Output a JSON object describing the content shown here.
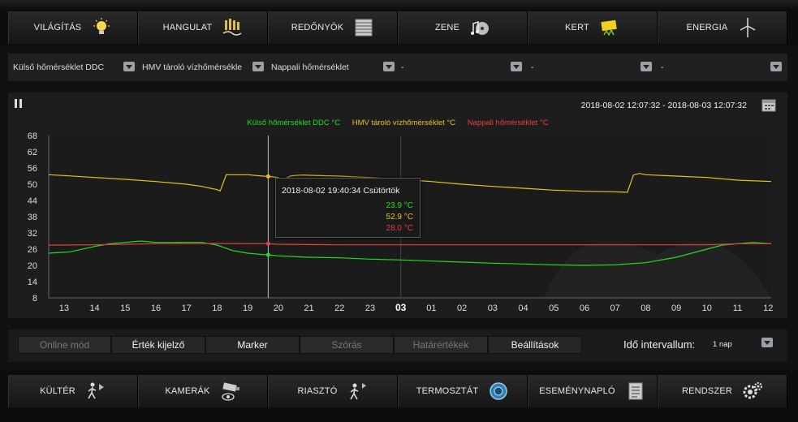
{
  "top_nav": [
    {
      "label": "VILÁGÍTÁS",
      "icon": "light-bulb-icon"
    },
    {
      "label": "HANGULAT",
      "icon": "mood-scene-icon"
    },
    {
      "label": "REDŐNYÖK",
      "icon": "blinds-icon"
    },
    {
      "label": "ZENE",
      "icon": "music-note-icon"
    },
    {
      "label": "KERT",
      "icon": "garden-icon"
    },
    {
      "label": "ENERGIA",
      "icon": "wind-turbine-icon"
    }
  ],
  "dropdowns": [
    {
      "label": "Külső hőmérséklet DDC"
    },
    {
      "label": "HMV tároló vízhőmérsékle"
    },
    {
      "label": "Nappali hőmérséklet"
    },
    {
      "label": "-"
    },
    {
      "label": "-"
    },
    {
      "label": "-"
    }
  ],
  "chart_header": {
    "range": "2018-08-02 12:07:32 - 2018-08-03 12:07:32"
  },
  "chart_data": {
    "type": "line",
    "y_ticks": [
      68,
      62,
      56,
      50,
      44,
      38,
      32,
      26,
      20,
      14,
      8
    ],
    "ylim": [
      8,
      68
    ],
    "x_ticks": [
      "13",
      "14",
      "15",
      "16",
      "17",
      "18",
      "19",
      "20",
      "21",
      "22",
      "23",
      "03",
      "01",
      "02",
      "03",
      "04",
      "05",
      "06",
      "07",
      "08",
      "09",
      "10",
      "11",
      "12"
    ],
    "xlim": [
      12.5,
      36.1
    ],
    "series": [
      {
        "name": "Külső hőmérséklet DDC °C",
        "color": "#22dd22",
        "x": [
          12.5,
          13.2,
          14,
          14.5,
          15,
          15.5,
          16,
          17,
          17.5,
          18,
          18.5,
          19,
          19.5,
          19.67,
          20,
          21,
          22,
          23,
          24,
          25,
          26,
          27,
          28,
          29,
          30,
          31,
          32,
          33,
          34,
          34.5,
          35,
          35.5,
          36.1
        ],
        "y": [
          24.5,
          25,
          27,
          28,
          28.5,
          29,
          28.5,
          28.5,
          28.5,
          27.5,
          25.5,
          24.5,
          24,
          23.9,
          23.5,
          23,
          22.8,
          22.3,
          22,
          21.6,
          21.2,
          20.8,
          20.5,
          20.2,
          20,
          20.2,
          21,
          23,
          26,
          27.5,
          28,
          28.5,
          28
        ]
      },
      {
        "name": "HMV tároló vízhőmérséklet °C",
        "color": "#e8c21a",
        "x": [
          12.5,
          13,
          14,
          15,
          16,
          17,
          17.5,
          18,
          18.1,
          18.3,
          19,
          19.5,
          19.67,
          20,
          20.1,
          20.4,
          20.5,
          20.8,
          21,
          22,
          23,
          24,
          25,
          26,
          27,
          28,
          29,
          30,
          31,
          31.4,
          31.6,
          31.8,
          32,
          33,
          34,
          35,
          36.1
        ],
        "y": [
          53.5,
          53.2,
          52.5,
          51.8,
          51,
          50,
          49.2,
          48,
          47.5,
          53.5,
          53.5,
          53,
          52.9,
          52.5,
          51.5,
          53,
          53.2,
          53.4,
          53.3,
          53,
          52.5,
          51.8,
          51,
          50,
          49.2,
          48.5,
          47.8,
          47.4,
          47.2,
          47,
          53.4,
          54,
          53.5,
          53,
          52.5,
          51.5,
          51
        ]
      },
      {
        "name": "Nappali hőmérséklet °C",
        "color": "#e64040",
        "x": [
          12.5,
          14,
          16,
          18,
          19.67,
          20,
          22,
          24,
          26,
          28,
          30,
          32,
          34,
          35,
          36.1
        ],
        "y": [
          27.5,
          27.6,
          28,
          28.1,
          28,
          27.8,
          27.6,
          27.6,
          27.6,
          27.6,
          27.6,
          27.6,
          27.6,
          28,
          28
        ]
      }
    ],
    "marker_x": 19.67,
    "grid": "vertical",
    "legend_position": "top-center"
  },
  "tooltip": {
    "header": "2018-08-02 19:40:34 Csütörtök",
    "values": [
      {
        "text": "23.9 °C",
        "color": "#22dd22"
      },
      {
        "text": "52.9 °C",
        "color": "#e8c21a"
      },
      {
        "text": "28.0 °C",
        "color": "#e64040"
      }
    ]
  },
  "controls": [
    {
      "label": "Online mód",
      "state": "disabled"
    },
    {
      "label": "Érték kijelző",
      "state": "active"
    },
    {
      "label": "Marker",
      "state": "active"
    },
    {
      "label": "Szórás",
      "state": "disabled"
    },
    {
      "label": "Határértékek",
      "state": "disabled"
    },
    {
      "label": "Beállítások",
      "state": "active"
    }
  ],
  "interval": {
    "label": "Idő intervallum:",
    "value": "1 nap"
  },
  "bottom_nav": [
    {
      "label": "KÜLTÉR",
      "icon": "outdoor-motion-icon"
    },
    {
      "label": "KAMERÁK",
      "icon": "camera-icon"
    },
    {
      "label": "RIASZTÓ",
      "icon": "alarm-icon"
    },
    {
      "label": "TERMOSZTÁT",
      "icon": "thermostat-icon"
    },
    {
      "label": "ESEMÉNYNAPLÓ",
      "icon": "event-log-icon"
    },
    {
      "label": "RENDSZER",
      "icon": "gears-icon"
    }
  ]
}
